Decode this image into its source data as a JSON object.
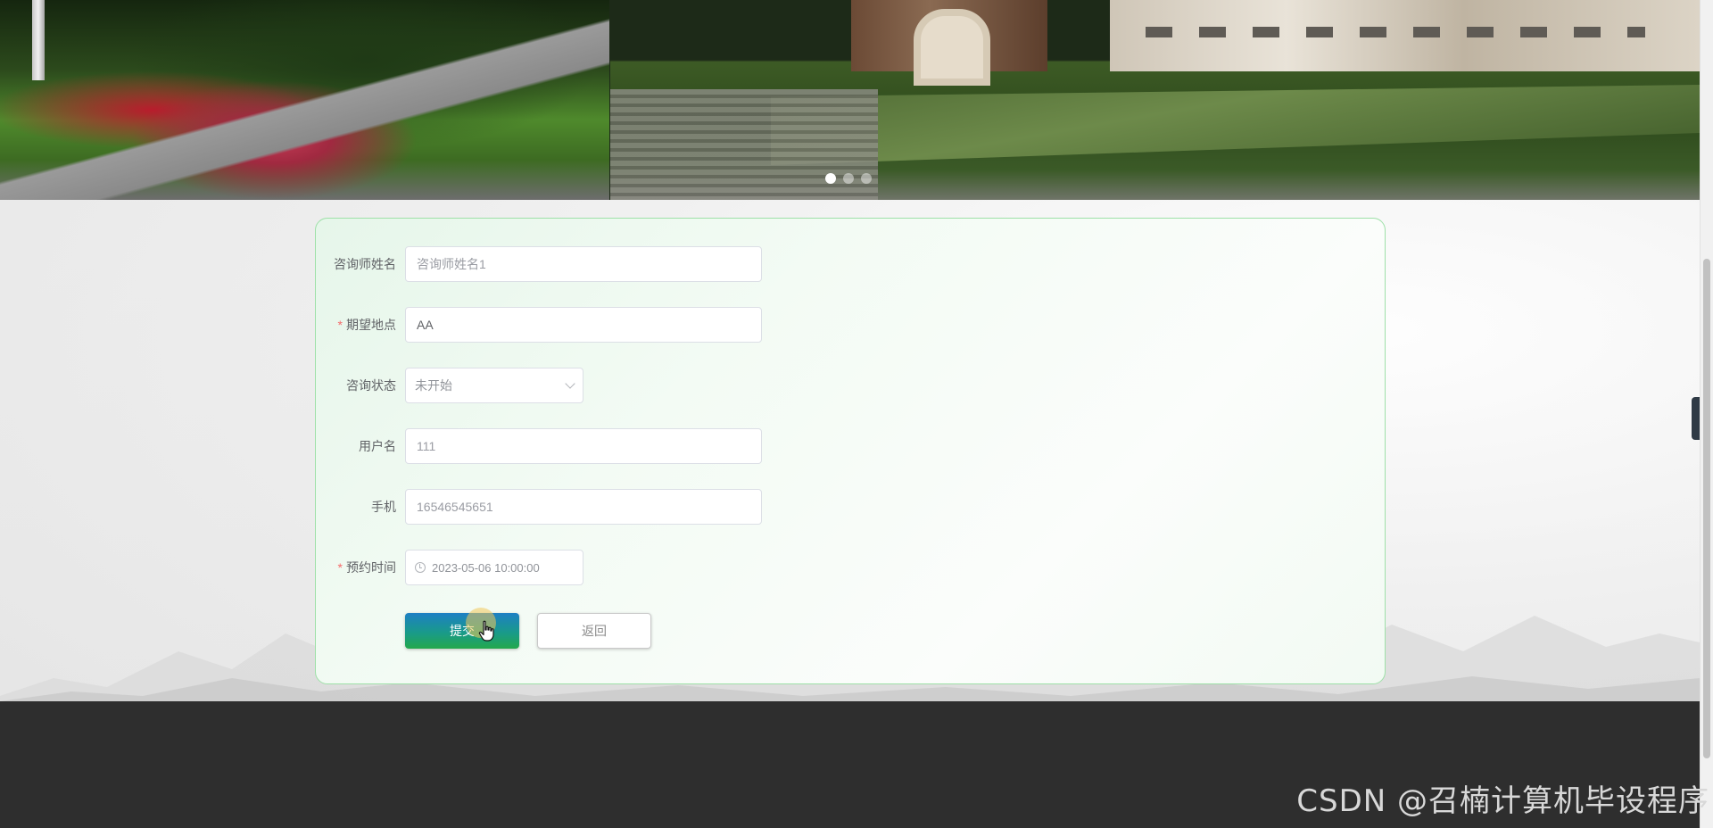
{
  "banner": {
    "dots": [
      {
        "active": true
      },
      {
        "active": false
      },
      {
        "active": false
      }
    ]
  },
  "form": {
    "fields": [
      {
        "label": "咨询师姓名",
        "required": false,
        "type": "text",
        "value": "咨询师姓名1",
        "readonly": true
      },
      {
        "label": "期望地点",
        "required": true,
        "type": "text",
        "value": "AA",
        "readonly": false
      },
      {
        "label": "咨询状态",
        "required": false,
        "type": "select",
        "value": "未开始"
      },
      {
        "label": "用户名",
        "required": false,
        "type": "text",
        "value": "111",
        "readonly": false
      },
      {
        "label": "手机",
        "required": false,
        "type": "text",
        "value": "16546545651",
        "readonly": false
      },
      {
        "label": "预约时间",
        "required": true,
        "type": "datetime",
        "value": "2023-05-06 10:00:00"
      }
    ],
    "required_mark": "*",
    "submit_label": "提交",
    "back_label": "返回"
  },
  "icons": {
    "select_arrow": "chevron-down-icon",
    "datetime": "clock-icon",
    "side_toggle": "chevron-left-icon",
    "pointer": "hand-cursor-icon"
  },
  "colors": {
    "card_border": "#9ee0a8",
    "required": "#f56c6c",
    "submit_gradient_top": "#1e7fc4",
    "submit_gradient_bottom": "#23a84c",
    "footer": "#2e2e2e"
  },
  "watermark": "CSDN @召楠计算机毕设程序"
}
